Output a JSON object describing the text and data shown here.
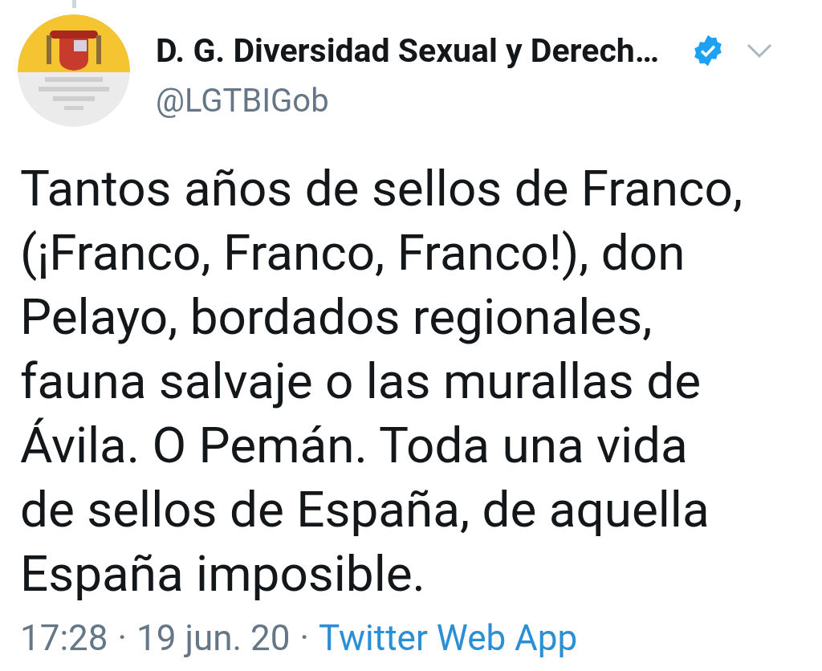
{
  "author": {
    "name": "D. G. Diversidad Sexual y Derech…",
    "handle": "@LGTBIGob",
    "verified": true
  },
  "text": "Tantos años de sellos de Franco,\n(¡Franco, Franco, Franco!), don\nPelayo, bordados regionales,\nfauna salvaje o las murallas de\nÁvila. O Pemán. Toda una vida\nde sellos de España, de aquella\nEspaña imposible.",
  "footer": {
    "time": "17:28",
    "separator_1": "·",
    "date": "19 jun. 20",
    "separator_2": "·",
    "source": "Twitter Web App"
  }
}
